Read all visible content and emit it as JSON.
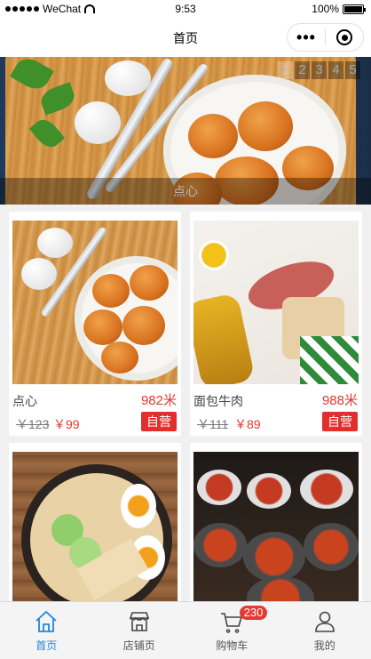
{
  "status_bar": {
    "carrier": "WeChat",
    "time": "9:53",
    "battery": "100%"
  },
  "nav_bar": {
    "title": "首页",
    "more_icon": "more-dots-icon",
    "close_icon": "target-icon"
  },
  "banner": {
    "pages": [
      "1",
      "2",
      "3",
      "4",
      "5"
    ],
    "active_page": 1,
    "caption": "点心"
  },
  "products": [
    {
      "name": "点心",
      "distance": "982米",
      "old_price": "￥123",
      "price": "￥99",
      "tag": "自营"
    },
    {
      "name": "面包牛肉",
      "distance": "988米",
      "old_price": "￥111",
      "price": "￥89",
      "tag": "自营"
    },
    {
      "name": "",
      "distance": "",
      "old_price": "",
      "price": "",
      "tag": ""
    },
    {
      "name": "",
      "distance": "",
      "old_price": "",
      "price": "",
      "tag": ""
    }
  ],
  "tab_bar": {
    "items": [
      {
        "label": "首页",
        "icon": "home-icon",
        "active": true
      },
      {
        "label": "店铺页",
        "icon": "store-icon",
        "active": false
      },
      {
        "label": "购物车",
        "icon": "cart-icon",
        "active": false,
        "badge": "230"
      },
      {
        "label": "我的",
        "icon": "user-icon",
        "active": false
      }
    ]
  },
  "colors": {
    "accent": "#1e88e5",
    "price": "#e2382f",
    "tag_bg": "#e32e2e",
    "badge": "#e53935"
  }
}
